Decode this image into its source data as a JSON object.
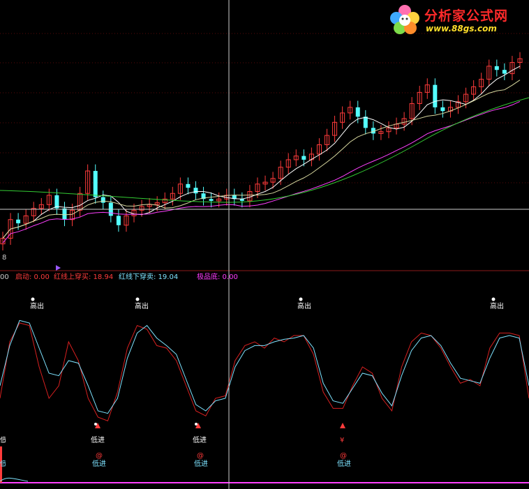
{
  "logo": {
    "title": "分析家公式网",
    "url": "www.88gs.com"
  },
  "price_panel": {
    "left_label": "8"
  },
  "indicator_header": {
    "lead": "00",
    "items": [
      {
        "text": "启动: 0.00",
        "color": "#ff3b3b"
      },
      {
        "text": "红线上穿买: 18.94",
        "color": "#ff3b3b"
      },
      {
        "text": "红线下穿卖: 19.04",
        "color": "#7ee3ff"
      },
      {
        "text": "极品底: 0.00",
        "color": "#ff3bff"
      }
    ]
  },
  "signals": {
    "high_out": "高出",
    "low_in": "低进",
    "at_mark": "@",
    "yen_mark": "¥"
  },
  "colors": {
    "up_candle": "#ff3b3b",
    "down_candle": "#54ffff",
    "ma_short": "#ffffff",
    "ma_mid": "#ff40ff",
    "ma_long": "#33cc33",
    "osc_red": "#d82020",
    "osc_cyan": "#7ee3ff",
    "divider": "#8b1a1a"
  },
  "chart_data": [
    {
      "type": "candlestick",
      "title": "",
      "series": [
        {
          "name": "",
          "values": [
            2.0,
            3.0,
            2.8,
            3.2,
            3.6,
            3.8,
            4.3,
            3.6,
            3.0,
            3.5,
            4.4,
            5.6,
            4.2,
            3.9,
            3.2,
            2.7,
            3.2,
            3.5,
            3.7,
            3.8,
            3.9,
            4.1,
            4.4,
            4.9,
            4.7,
            4.4,
            4.1,
            4.0,
            4.1,
            4.3,
            4.1,
            4.0,
            4.5,
            4.9,
            5.0,
            5.2,
            5.8,
            6.2,
            6.4,
            6.2,
            6.5,
            7.0,
            7.5,
            8.2,
            8.7,
            9.0,
            8.5,
            7.9,
            7.6,
            7.7,
            7.9,
            8.1,
            8.4,
            9.2,
            9.8,
            10.2,
            9.0,
            8.8,
            9.0,
            9.3,
            9.7,
            10.1,
            10.5,
            11.2,
            11.0,
            10.8,
            11.4,
            11.6
          ]
        }
      ]
    },
    {
      "type": "line",
      "title": "",
      "series": [
        {
          "name": "",
          "values": [
            30,
            75,
            90,
            88,
            55,
            30,
            40,
            75,
            60,
            30,
            15,
            12,
            35,
            70,
            88,
            85,
            72,
            70,
            60,
            40,
            20,
            16,
            30,
            32,
            60,
            72,
            75,
            70,
            78,
            75,
            80,
            80,
            65,
            35,
            22,
            22,
            40,
            55,
            50,
            30,
            20,
            55,
            75,
            82,
            80,
            70,
            55,
            42,
            45,
            40,
            70,
            82,
            82,
            80,
            30
          ]
        },
        {
          "name": "",
          "values": [
            40,
            72,
            92,
            90,
            70,
            50,
            48,
            60,
            58,
            40,
            20,
            18,
            30,
            62,
            82,
            88,
            78,
            72,
            65,
            45,
            25,
            20,
            28,
            30,
            55,
            68,
            72,
            72,
            75,
            77,
            78,
            80,
            70,
            42,
            28,
            26,
            38,
            50,
            48,
            34,
            24,
            48,
            68,
            78,
            80,
            72,
            58,
            46,
            44,
            42,
            62,
            78,
            80,
            78,
            40
          ]
        }
      ]
    }
  ]
}
